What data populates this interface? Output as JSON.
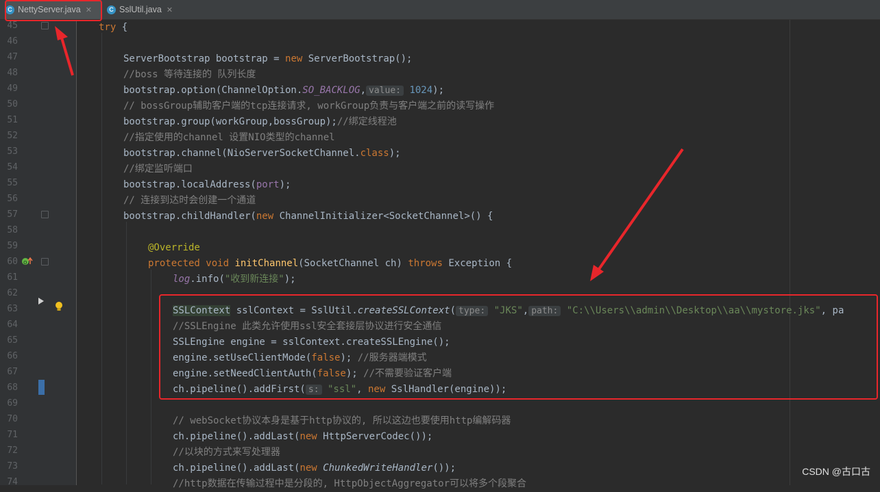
{
  "tabs": [
    {
      "label": "NettyServer.java",
      "active": true,
      "icon": "class-c-icon"
    },
    {
      "label": "SslUtil.java",
      "active": false,
      "icon": "class-c-icon"
    }
  ],
  "watermark": "CSDN @古口古",
  "colors": {
    "annotation": "#e8262b",
    "accent": "#3592c4",
    "background": "#2b2b2b"
  },
  "lines": [
    {
      "n": "45",
      "t": "try {"
    },
    {
      "n": "46",
      "t": ""
    },
    {
      "n": "47",
      "t": "ServerBootstrap bootstrap = new ServerBootstrap();"
    },
    {
      "n": "48",
      "t": "//boss 等待连接的 队列长度"
    },
    {
      "n": "49",
      "t": "bootstrap.option(ChannelOption.SO_BACKLOG, value: 1024);"
    },
    {
      "n": "50",
      "t": "// bossGroup辅助客户端的tcp连接请求, workGroup负责与客户端之前的读写操作"
    },
    {
      "n": "51",
      "t": "bootstrap.group(workGroup,bossGroup);//绑定线程池"
    },
    {
      "n": "52",
      "t": "//指定使用的channel 设置NIO类型的channel"
    },
    {
      "n": "53",
      "t": "bootstrap.channel(NioServerSocketChannel.class);"
    },
    {
      "n": "54",
      "t": "//绑定监听端口"
    },
    {
      "n": "55",
      "t": "bootstrap.localAddress(port);"
    },
    {
      "n": "56",
      "t": "// 连接到达时会创建一个通道"
    },
    {
      "n": "57",
      "t": "bootstrap.childHandler(new ChannelInitializer<SocketChannel>() {"
    },
    {
      "n": "58",
      "t": ""
    },
    {
      "n": "59",
      "t": "@Override"
    },
    {
      "n": "60",
      "t": "protected void initChannel(SocketChannel ch) throws Exception {"
    },
    {
      "n": "61",
      "t": "log.info(\"收到新连接\");"
    },
    {
      "n": "62",
      "t": ""
    },
    {
      "n": "63",
      "t": "SSLContext sslContext = SslUtil.createSSLContext( type: \"JKS\", path: \"C:\\\\Users\\\\admin\\\\Desktop\\\\aa\\\\mystore.jks\", pa"
    },
    {
      "n": "64",
      "t": "//SSLEngine 此类允许使用ssl安全套接层协议进行安全通信"
    },
    {
      "n": "65",
      "t": "SSLEngine engine = sslContext.createSSLEngine();"
    },
    {
      "n": "66",
      "t": "engine.setUseClientMode(false); //服务器端模式"
    },
    {
      "n": "67",
      "t": "engine.setNeedClientAuth(false); //不需要验证客户端"
    },
    {
      "n": "68",
      "t": "ch.pipeline().addFirst( s: \"ssl\", new SslHandler(engine));"
    },
    {
      "n": "69",
      "t": ""
    },
    {
      "n": "70",
      "t": "// webSocket协议本身是基于http协议的, 所以这边也要使用http编解码器"
    },
    {
      "n": "71",
      "t": "ch.pipeline().addLast(new HttpServerCodec());"
    },
    {
      "n": "72",
      "t": "//以块的方式来写处理器"
    },
    {
      "n": "73",
      "t": "ch.pipeline().addLast(new ChunkedWriteHandler());"
    },
    {
      "n": "74",
      "t": "//http数据在传输过程中是分段的, HttpObjectAggregator可以将多个段聚合"
    }
  ]
}
